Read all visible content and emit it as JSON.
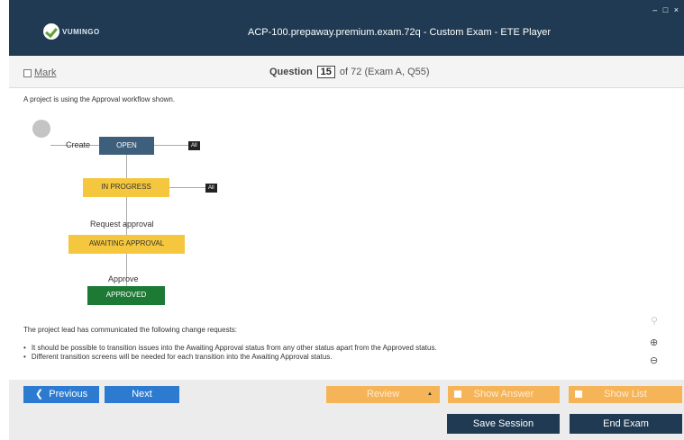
{
  "window": {
    "title": "ACP-100.prepaway.premium.exam.72q - Custom Exam - ETE Player",
    "logo_text": "VUMINGO",
    "controls": "– □ ×"
  },
  "question_bar": {
    "mark_label": "Mark",
    "question_label": "Question",
    "question_number": "15",
    "of_text": "of 72 (Exam A, Q55)"
  },
  "question": {
    "intro": "A project is using the Approval workflow shown.",
    "lead": "The project lead has communicated the following change requests:",
    "bullets": [
      "It should be possible to transition issues into the Awaiting Approval status from any other status apart from the Approved status.",
      "Different transition screens will be needed for each transition into the Awaiting Approval status."
    ]
  },
  "workflow": {
    "transitions": {
      "create": "Create",
      "request_approval": "Request approval",
      "approve": "Approve"
    },
    "statuses": {
      "open": "OPEN",
      "in_progress": "IN PROGRESS",
      "awaiting_approval": "AWAITING APPROVAL",
      "approved": "APPROVED"
    },
    "all_tag": "All",
    "colors": {
      "open": "#3d5f7c",
      "in_progress": "#f5c73e",
      "awaiting_approval": "#f5c73e",
      "approved": "#1c7a35"
    }
  },
  "tools": {
    "search_icon": "search-icon",
    "zoom_in_icon": "zoom-in-icon",
    "zoom_out_icon": "zoom-out-icon"
  },
  "nav": {
    "previous": "Previous",
    "next": "Next",
    "review": "Review",
    "show_answer": "Show Answer",
    "show_list": "Show List",
    "save_session": "Save Session",
    "end_exam": "End Exam"
  },
  "colors": {
    "titlebar": "#1f3a52",
    "nav_blue": "#2d7bd0",
    "orange": "#f6b459"
  }
}
